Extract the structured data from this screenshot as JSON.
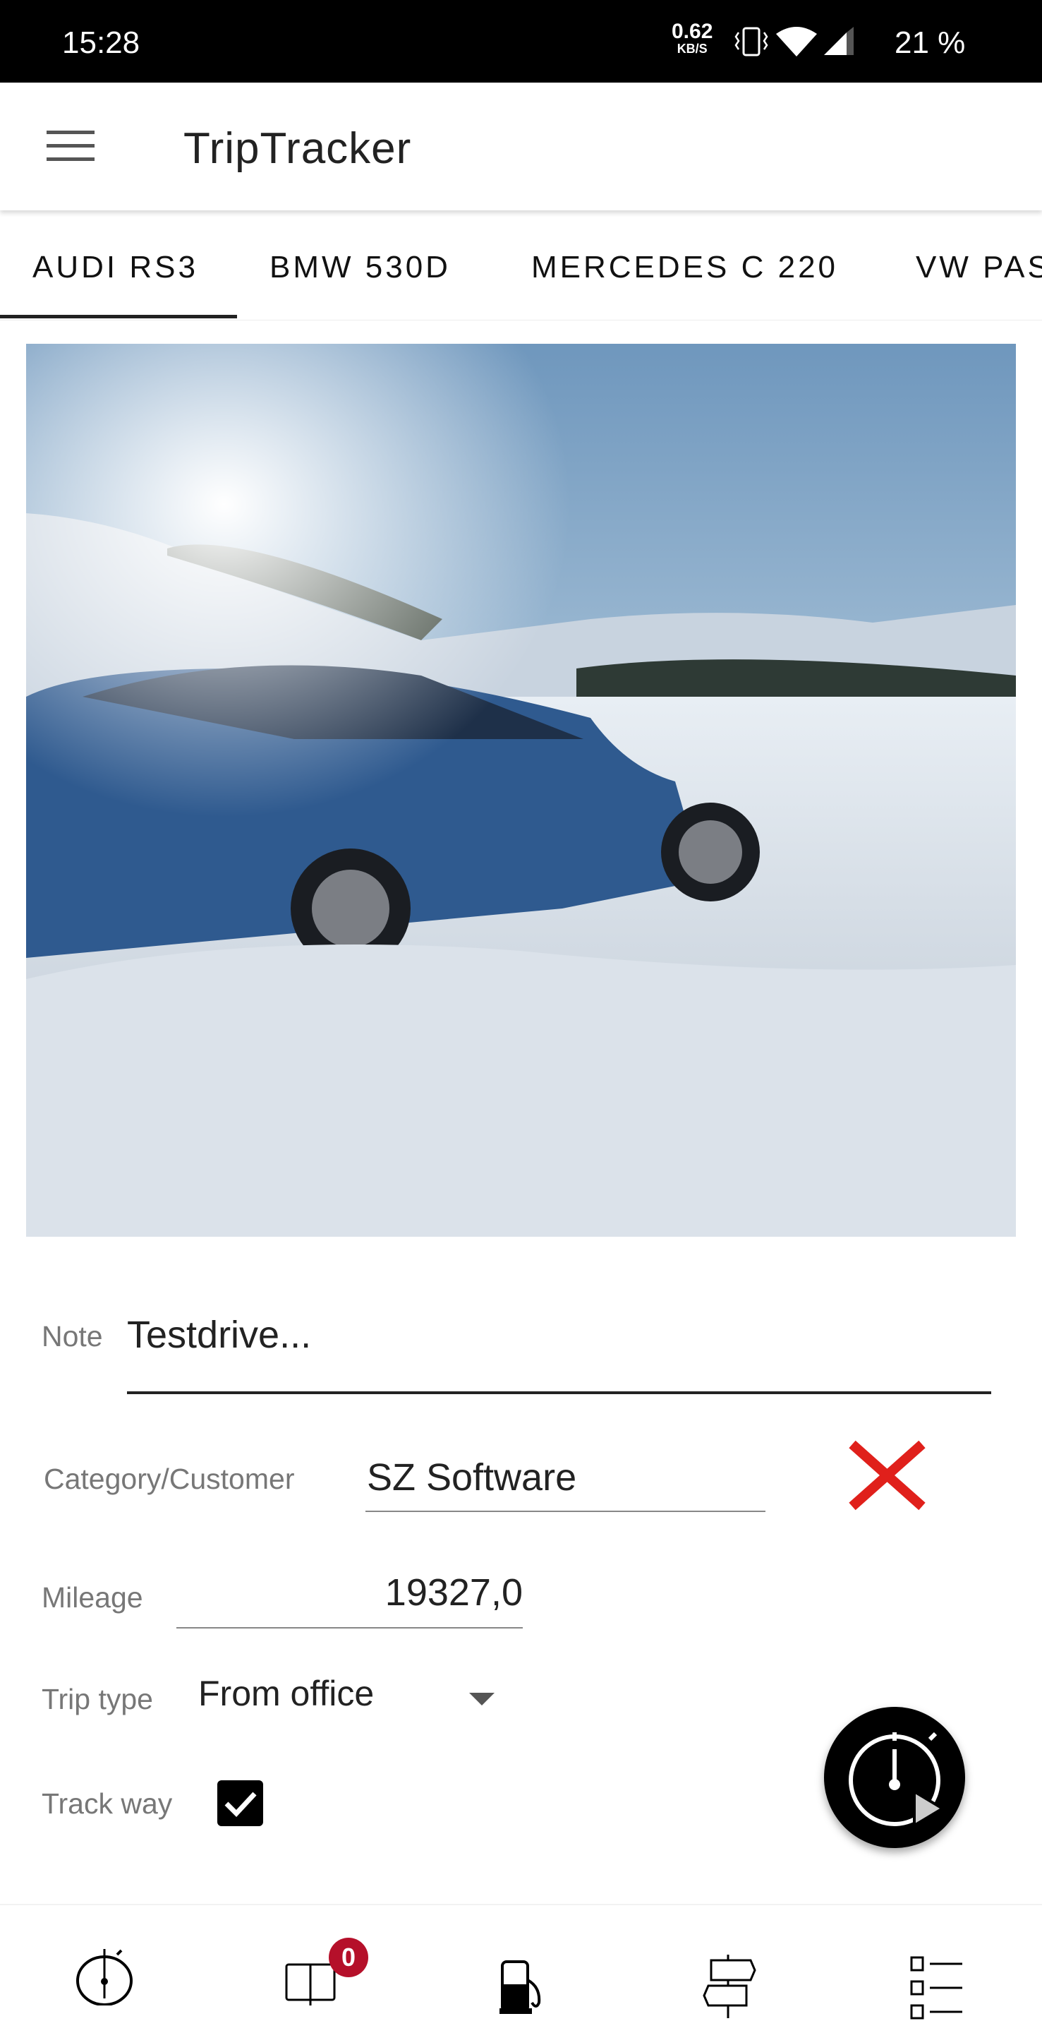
{
  "status_bar": {
    "time": "15:28",
    "net_speed": "0.62",
    "net_unit": "KB/S",
    "battery": "21 %",
    "icons": [
      "vibrate-icon",
      "wifi-icon",
      "signal-icon"
    ]
  },
  "app_bar": {
    "title": "TripTracker",
    "menu_icon": "hamburger-icon"
  },
  "tabs": [
    {
      "label": "AUDI RS3",
      "selected": true
    },
    {
      "label": "BMW 530D"
    },
    {
      "label": "MERCEDES C 220"
    },
    {
      "label": "VW PASSAT"
    }
  ],
  "form": {
    "note": {
      "label": "Note",
      "value": "Testdrive..."
    },
    "category": {
      "label": "Category/Customer",
      "value": "SZ Software",
      "clear_icon": "red-x-icon",
      "clear_color": "#e0201b"
    },
    "mileage": {
      "label": "Mileage",
      "value": "19327,0"
    },
    "trip_type": {
      "label": "Trip type",
      "value": "From office"
    },
    "track_way": {
      "label": "Track way",
      "checked": true
    }
  },
  "fab": {
    "icon": "stopwatch-play-icon"
  },
  "bottom_nav": {
    "items": [
      {
        "icon": "stopwatch-icon"
      },
      {
        "icon": "book-icon",
        "badge": "0"
      },
      {
        "icon": "fuel-pump-icon"
      },
      {
        "icon": "signpost-icon"
      },
      {
        "icon": "checklist-icon"
      }
    ],
    "badge_color": "#b5102a"
  }
}
